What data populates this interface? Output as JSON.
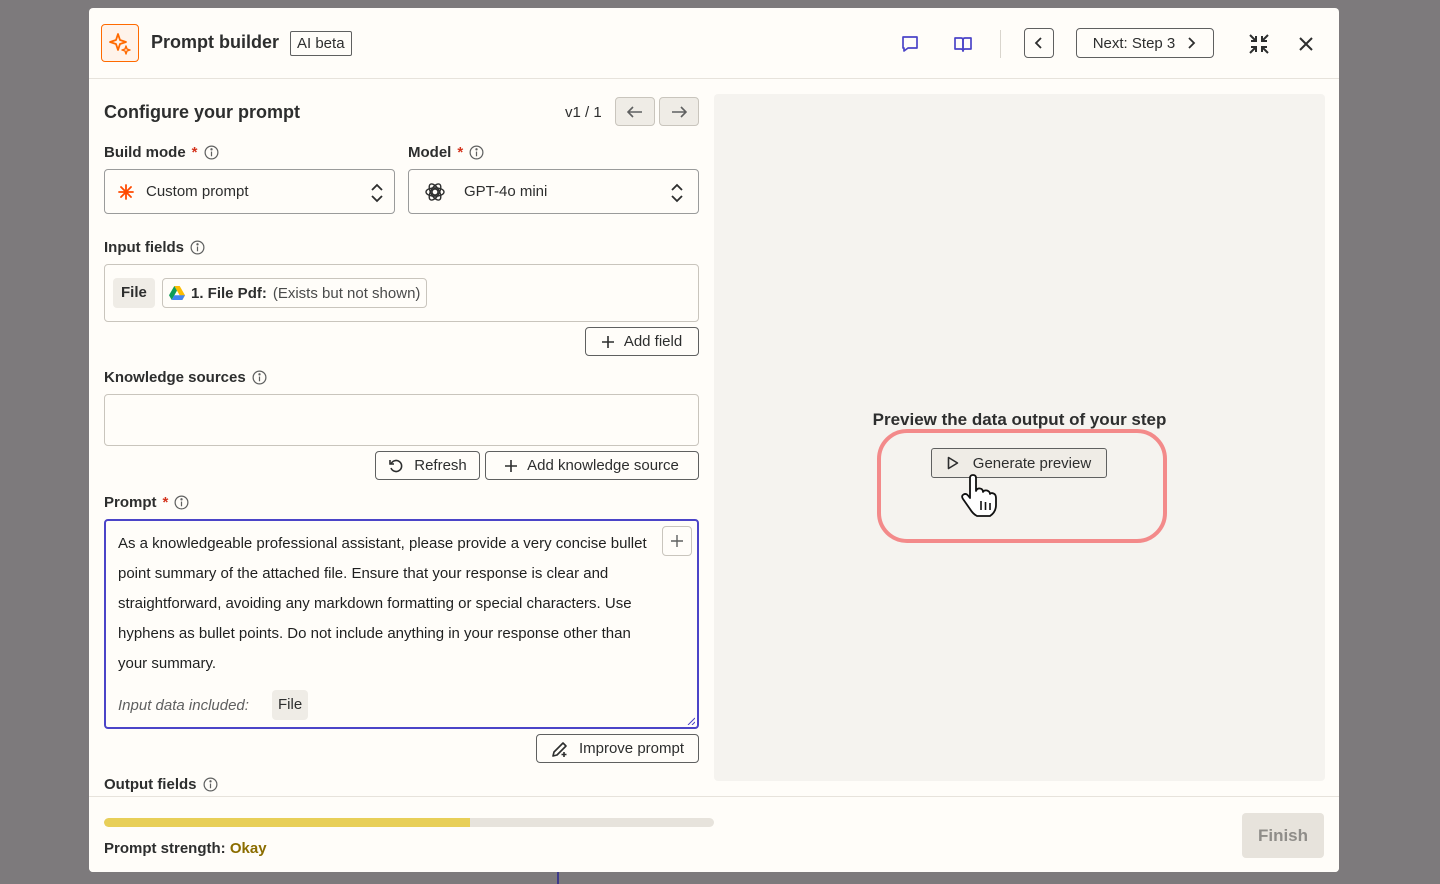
{
  "header": {
    "title": "Prompt builder",
    "badge": "AI beta",
    "next_step_label": "Next: Step 3"
  },
  "config": {
    "title": "Configure your prompt",
    "version": "v1 / 1"
  },
  "build_mode": {
    "label": "Build mode",
    "required_mark": "*",
    "value": "Custom prompt"
  },
  "model": {
    "label": "Model",
    "required_mark": "*",
    "value": "GPT-4o mini"
  },
  "input_fields": {
    "label": "Input fields",
    "chip_type": "File",
    "file_name": "1. File Pdf:",
    "file_status": "(Exists but not shown)",
    "add_field_label": "Add field"
  },
  "knowledge": {
    "label": "Knowledge sources",
    "refresh_label": "Refresh",
    "add_label": "Add knowledge source"
  },
  "prompt": {
    "label": "Prompt",
    "required_mark": "*",
    "text": "As a knowledgeable professional assistant, please provide a very concise bullet point summary of the attached file. Ensure that your response is clear and straightforward, avoiding any markdown formatting or special characters. Use hyphens as bullet points. Do not include anything in your response other than your summary.",
    "included_label": "Input data included:",
    "included_chip": "File",
    "improve_label": "Improve prompt"
  },
  "output_fields": {
    "label": "Output fields"
  },
  "preview": {
    "title": "Preview the data output of your step",
    "generate_label": "Generate preview"
  },
  "footer": {
    "strength_label": "Prompt strength:",
    "strength_value": "Okay",
    "strength_fraction": 0.6,
    "finish_label": "Finish"
  },
  "colors": {
    "accent": "#4b44c8",
    "brand_orange": "#ff6a00",
    "highlight_ring": "#f38a8a",
    "strength_bar": "#e8cf58"
  },
  "icons": {
    "logo": "sparkle-icon",
    "comment": "comment-icon",
    "docs": "book-icon",
    "minimize": "collapse-icon",
    "close": "close-icon"
  }
}
